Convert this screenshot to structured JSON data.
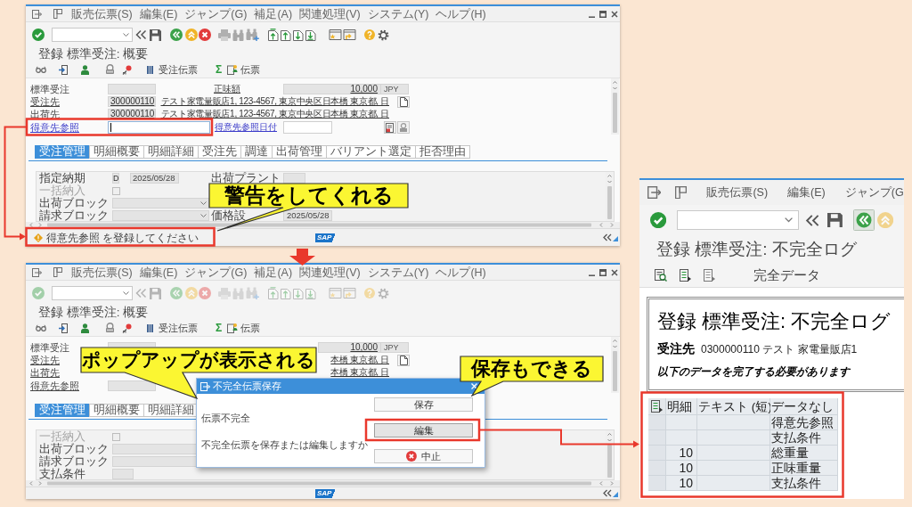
{
  "windows": [
    {
      "menu": [
        "販売伝票(S)",
        "編集(E)",
        "ジャンプ(G)",
        "補足(A)",
        "関連処理(V)",
        "システム(Y)",
        "ヘルプ(H)"
      ],
      "dimmed": false,
      "title": "登録 標準受注: 概要",
      "app_toolbar": [
        {
          "kind": "order",
          "label": "受注伝票"
        },
        {
          "kind": "sum",
          "label": "Σ"
        },
        {
          "kind": "document",
          "label": "伝票"
        }
      ],
      "header": [
        {
          "kind": "amount",
          "label": "標準受注",
          "amount_label": "正味額",
          "amount": "10,000",
          "currency": "JPY"
        },
        {
          "kind": "partner",
          "label": "受注先",
          "number": "300000110",
          "address": "テスト家電量販店1, 123-4567, 東京中央区日本橋 東京都, 日",
          "doc_button": true
        },
        {
          "kind": "partner",
          "label": "出荷先",
          "number": "300000110",
          "address": "テスト家電量販店1, 123-4567, 東京中央区日本橋 東京都, 日"
        },
        {
          "kind": "reference",
          "label": "得意先参照",
          "editable": true,
          "focused": true,
          "date_label": "得意先参照日付"
        }
      ],
      "tabs": [
        {
          "label": "受注管理",
          "selected": true
        },
        {
          "label": "明細概要",
          "selected": false
        },
        {
          "label": "明細詳細",
          "selected": false
        },
        {
          "label": "受注先",
          "selected": false
        },
        {
          "label": "調達",
          "selected": false
        },
        {
          "label": "出荷管理",
          "selected": false
        },
        {
          "label": "バリアント選定",
          "selected": false
        },
        {
          "label": "拒否理由",
          "selected": false
        }
      ],
      "tab_fields": [
        {
          "kind": "date",
          "label": "指定納期",
          "disabled": false,
          "code": "D",
          "value": "2025/05/28",
          "side_label": "出荷プラント"
        },
        {
          "kind": "checkbox",
          "label": "一括納入",
          "disabled": true,
          "checked": false
        },
        {
          "kind": "dropdown",
          "label": "出荷ブロック",
          "disabled": false
        },
        {
          "kind": "dropdown",
          "label": "請求ブロック",
          "disabled": false,
          "side_label": "価格設",
          "side_value": "2025/05/28"
        }
      ],
      "status": {
        "kind": "warning",
        "message": "得意先参照 を登録してください"
      },
      "logo": "SAP"
    },
    {
      "menu": [
        "販売伝票(S)",
        "編集(E)",
        "ジャンプ(G)",
        "補足(A)",
        "関連処理(V)",
        "システム(Y)",
        "ヘルプ(H)"
      ],
      "dimmed": true,
      "title": "登録 標準受注: 概要",
      "app_toolbar": [
        {
          "kind": "order",
          "label": "受注伝票"
        },
        {
          "kind": "sum",
          "label": "Σ"
        },
        {
          "kind": "document",
          "label": "伝票"
        }
      ],
      "header": [
        {
          "kind": "amount",
          "label": "標準受注",
          "amount": "10,000",
          "currency": "JPY"
        },
        {
          "kind": "partner",
          "label": "受注先",
          "address": "本橋 東京都, 日",
          "doc_button": true
        },
        {
          "kind": "partner",
          "label": "出荷先",
          "address": "本橋 東京都, 日"
        },
        {
          "kind": "reference",
          "label": "得意先参照",
          "editable": false,
          "focused": false
        }
      ],
      "tabs": [
        {
          "label": "受注管理",
          "selected": true
        },
        {
          "label": "明細概要",
          "selected": false
        },
        {
          "label": "明細詳細",
          "selected": false
        }
      ],
      "tab_fields": [
        {
          "kind": "checkbox",
          "label": "一括納入",
          "disabled": true,
          "checked": false
        },
        {
          "kind": "dropdown",
          "label": "出荷ブロック",
          "disabled": false
        },
        {
          "kind": "dropdown",
          "label": "請求ブロック",
          "disabled": false
        },
        {
          "kind": "text",
          "label": "支払条件",
          "disabled": false
        }
      ],
      "logo": "SAP"
    }
  ],
  "dialog": {
    "title": "不完全伝票保存",
    "heading": "伝票不完全",
    "message": "不完全伝票を保存または編集しますか",
    "buttons": [
      {
        "kind": "plain",
        "label": "保存",
        "focused": false
      },
      {
        "kind": "plain",
        "label": "編集",
        "focused": true
      },
      {
        "kind": "cancel",
        "label": "中止",
        "focused": false
      }
    ]
  },
  "log_window": {
    "menu": [
      "販売伝票(S)",
      "編集(E)",
      "ジャンプ(G"
    ],
    "title": "登録 標準受注: 不完全ログ",
    "app_toolbar": [
      {
        "label": "完全データ"
      }
    ],
    "heading": "登録 標準受注: 不完全ログ",
    "partner_label": "受注先",
    "partner": "0300000110 テスト 家電量販店1",
    "note": "以下のデータを完了する必要があります",
    "table": {
      "columns": [
        "明細",
        "テキスト (短)",
        "データなし"
      ],
      "rows": [
        {
          "field": "得意先参照"
        },
        {
          "field": "支払条件"
        },
        {
          "item": "10",
          "field": "総重量"
        },
        {
          "item": "10",
          "field": "正味重量"
        },
        {
          "item": "10",
          "field": "支払条件"
        }
      ]
    }
  },
  "callouts": [
    {
      "text": "警告をしてくれる"
    },
    {
      "text": "ポップアップが表示される"
    },
    {
      "text": "保存もできる"
    }
  ]
}
